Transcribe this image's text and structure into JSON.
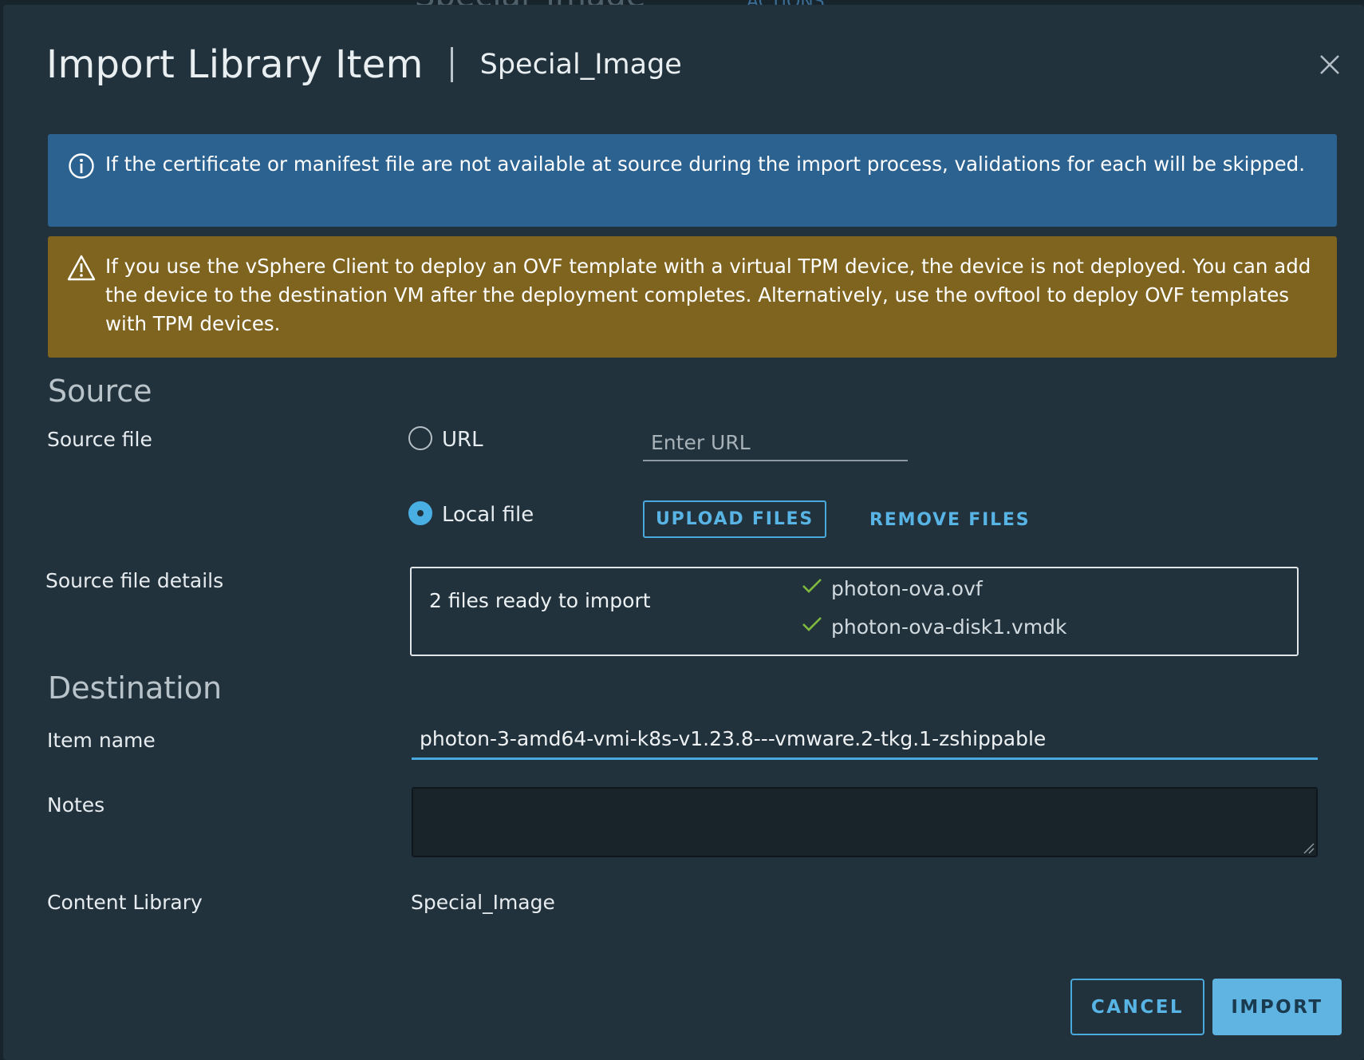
{
  "background": {
    "title": "Special_Image",
    "actions_label": "ACTIONS"
  },
  "dialog": {
    "title": "Import Library Item",
    "subtitle": "Special_Image",
    "close_icon": "close-icon"
  },
  "alerts": {
    "info": {
      "icon": "info-circle-icon",
      "text": "If the certificate or manifest file are not available at source during the import process, validations for each will be skipped.",
      "color": "#2c6290"
    },
    "warning": {
      "icon": "warning-triangle-icon",
      "text": "If you use the vSphere Client to deploy an OVF template with a virtual TPM device, the device is not deployed. You can add the device to the destination VM after the deployment completes. Alternatively, use the ovftool to deploy OVF templates with TPM devices.",
      "color": "#7f6420"
    }
  },
  "source": {
    "section_title": "Source",
    "source_file_label": "Source file",
    "url_option_label": "URL",
    "url_selected": false,
    "url_placeholder": "Enter URL",
    "local_option_label": "Local file",
    "local_selected": true,
    "upload_button_label": "UPLOAD FILES",
    "remove_button_label": "REMOVE FILES",
    "details_label": "Source file details",
    "details_summary": "2 files ready to import",
    "files": [
      {
        "name": "photon-ova.ovf",
        "status_icon": "check-icon"
      },
      {
        "name": "photon-ova-disk1.vmdk",
        "status_icon": "check-icon"
      }
    ]
  },
  "destination": {
    "section_title": "Destination",
    "item_name_label": "Item name",
    "item_name_value": "photon-3-amd64-vmi-k8s-v1.23.8---vmware.2-tkg.1-zshippable",
    "notes_label": "Notes",
    "notes_value": "",
    "content_library_label": "Content Library",
    "content_library_value": "Special_Image"
  },
  "footer": {
    "cancel_label": "CANCEL",
    "import_label": "IMPORT"
  },
  "colors": {
    "accent": "#49aee1",
    "check": "#7fba3e"
  }
}
